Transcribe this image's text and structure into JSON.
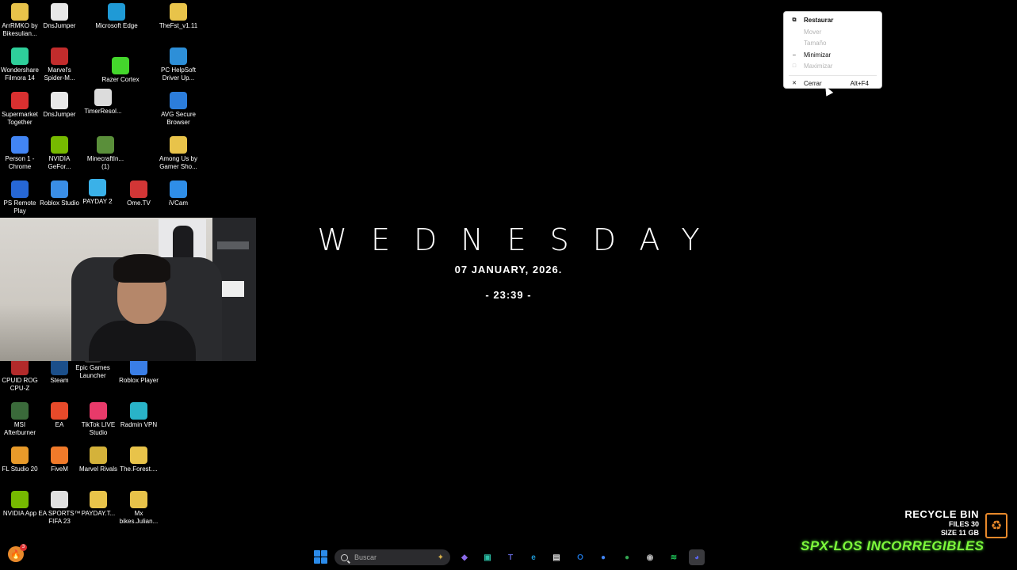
{
  "desktop_icons": [
    {
      "label": "ArrRMKO by Bikesulian...",
      "icon": "folder-icon",
      "color": "#e8c34a"
    },
    {
      "label": "DnsJumper",
      "icon": "dnsjumper-icon",
      "color": "#e8e8e8"
    },
    {
      "label": "Microsoft Edge",
      "icon": "edge-icon",
      "color": "#1f9ad6"
    },
    {
      "label": "TheFst_v1.11",
      "icon": "folder-icon",
      "color": "#e8c34a"
    },
    {
      "label": "Wondershare Filmora 14",
      "icon": "filmora-icon",
      "color": "#2ecf9a"
    },
    {
      "label": "Marvel's Spider-M...",
      "icon": "spiderman-icon",
      "color": "#c22c2c"
    },
    {
      "label": "Razer Cortex",
      "icon": "razer-icon",
      "color": "#44d62c"
    },
    {
      "label": "PC HelpSoft Driver Up...",
      "icon": "driver-updater-icon",
      "color": "#2d8fd8"
    },
    {
      "label": "Supermarket Together",
      "icon": "supermarket-icon",
      "color": "#d93030"
    },
    {
      "label": "DnsJumper",
      "icon": "dnsjumper-icon",
      "color": "#e8e8e8"
    },
    {
      "label": "TimerResol...",
      "icon": "timer-icon",
      "color": "#dcdcdc"
    },
    {
      "label": "AVG Secure Browser",
      "icon": "avg-icon",
      "color": "#2c7ddb"
    },
    {
      "label": "Person 1 - Chrome",
      "icon": "chrome-icon",
      "color": "#4285f4"
    },
    {
      "label": "NVIDIA GeFor...",
      "icon": "nvidia-icon",
      "color": "#76b900"
    },
    {
      "label": "MinecraftIn... (1)",
      "icon": "minecraft-icon",
      "color": "#5a8f3a"
    },
    {
      "label": "Among Us by Gamer Sho...",
      "icon": "folder-icon",
      "color": "#e8c34a"
    },
    {
      "label": "PS Remote Play",
      "icon": "ps-remote-icon",
      "color": "#2667d6"
    },
    {
      "label": "Roblox Studio",
      "icon": "roblox-studio-icon",
      "color": "#3a8ee6"
    },
    {
      "label": "PAYDAY 2",
      "icon": "payday-icon",
      "color": "#3ab1e8"
    },
    {
      "label": "Ome.TV",
      "icon": "ometv-icon",
      "color": "#d23636"
    },
    {
      "label": "iVCam",
      "icon": "ivcam-icon",
      "color": "#2f8ee8"
    },
    {
      "label": "CPUID ROG CPU-Z",
      "icon": "cpuz-icon",
      "color": "#b22a2a"
    },
    {
      "label": "Steam",
      "icon": "steam-icon",
      "color": "#1b4f8a"
    },
    {
      "label": "Epic Games Launcher",
      "icon": "epic-icon",
      "color": "#333333"
    },
    {
      "label": "Roblox Player",
      "icon": "roblox-icon",
      "color": "#3a7ee6"
    },
    {
      "label": "MSI Afterburner",
      "icon": "afterburner-icon",
      "color": "#3a6a3a"
    },
    {
      "label": "EA",
      "icon": "ea-icon",
      "color": "#e84a2a"
    },
    {
      "label": "TikTok LIVE Studio",
      "icon": "tiktok-icon",
      "color": "#e83a6a"
    },
    {
      "label": "Radmin VPN",
      "icon": "radmin-icon",
      "color": "#29b3c8"
    },
    {
      "label": "FL Studio 20",
      "icon": "flstudio-icon",
      "color": "#e89a2a"
    },
    {
      "label": "FiveM",
      "icon": "fivem-icon",
      "color": "#f07a2a"
    },
    {
      "label": "Marvel Rivals",
      "icon": "marvel-rivals-icon",
      "color": "#d4b23a"
    },
    {
      "label": "The.Forest....",
      "icon": "folder-icon",
      "color": "#e8c34a"
    },
    {
      "label": "NVIDIA App",
      "icon": "nvidia-app-icon",
      "color": "#76b900"
    },
    {
      "label": "EA SPORTS™ FIFA 23",
      "icon": "fifa-icon",
      "color": "#e0e0e0"
    },
    {
      "label": "PAYDAY.T...",
      "icon": "folder-icon",
      "color": "#e8c34a"
    },
    {
      "label": "Mx bikes.Julian...",
      "icon": "folder-icon",
      "color": "#e8c34a"
    }
  ],
  "clock_widget": {
    "day": "WEDNESDAY",
    "date": "07  JANUARY,  2026.",
    "time": "- 23:39 -"
  },
  "context_menu": {
    "items": [
      {
        "label": "Restaurar",
        "icon": "restore-icon",
        "glyph": "⧉",
        "enabled": true,
        "bold": true,
        "shortcut": ""
      },
      {
        "label": "Mover",
        "icon": "move-icon",
        "glyph": "",
        "enabled": false,
        "bold": false,
        "shortcut": ""
      },
      {
        "label": "Tamaño",
        "icon": "size-icon",
        "glyph": "",
        "enabled": false,
        "bold": false,
        "shortcut": ""
      },
      {
        "label": "Minimizar",
        "icon": "minimize-icon",
        "glyph": "–",
        "enabled": true,
        "bold": false,
        "shortcut": ""
      },
      {
        "label": "Maximizar",
        "icon": "maximize-icon",
        "glyph": "□",
        "enabled": false,
        "bold": false,
        "shortcut": ""
      },
      {
        "label": "Cerrar",
        "icon": "close-icon",
        "glyph": "✕",
        "enabled": true,
        "bold": false,
        "shortcut": "Alt+F4"
      }
    ]
  },
  "recycle_bin": {
    "title": "RECYCLE BIN",
    "files": "FILES 30",
    "size": "SIZE 11 GB"
  },
  "watermark": "SPX-LOS INCORREGIBLES",
  "taskbar": {
    "search_placeholder": "Buscar",
    "tray_badge": "3",
    "apps": [
      {
        "name": "copilot-icon",
        "glyph": "◆",
        "color": "#8a6ae8"
      },
      {
        "name": "meet-icon",
        "glyph": "▣",
        "color": "#2cbfa6"
      },
      {
        "name": "teams-icon",
        "glyph": "T",
        "color": "#5b5fc7"
      },
      {
        "name": "edge-icon",
        "glyph": "e",
        "color": "#1f9ad6"
      },
      {
        "name": "cod-icon",
        "glyph": "▤",
        "color": "#dddddd"
      },
      {
        "name": "outlook-icon",
        "glyph": "O",
        "color": "#1c6fd1"
      },
      {
        "name": "chrome-icon",
        "glyph": "●",
        "color": "#4285f4"
      },
      {
        "name": "chrome-profile-icon",
        "glyph": "●",
        "color": "#34a853"
      },
      {
        "name": "obs-icon",
        "glyph": "◉",
        "color": "#bbbbbb"
      },
      {
        "name": "spotify-icon",
        "glyph": "≋",
        "color": "#1db954"
      },
      {
        "name": "discord-icon",
        "glyph": "◕",
        "color": "#5865f2"
      }
    ]
  }
}
